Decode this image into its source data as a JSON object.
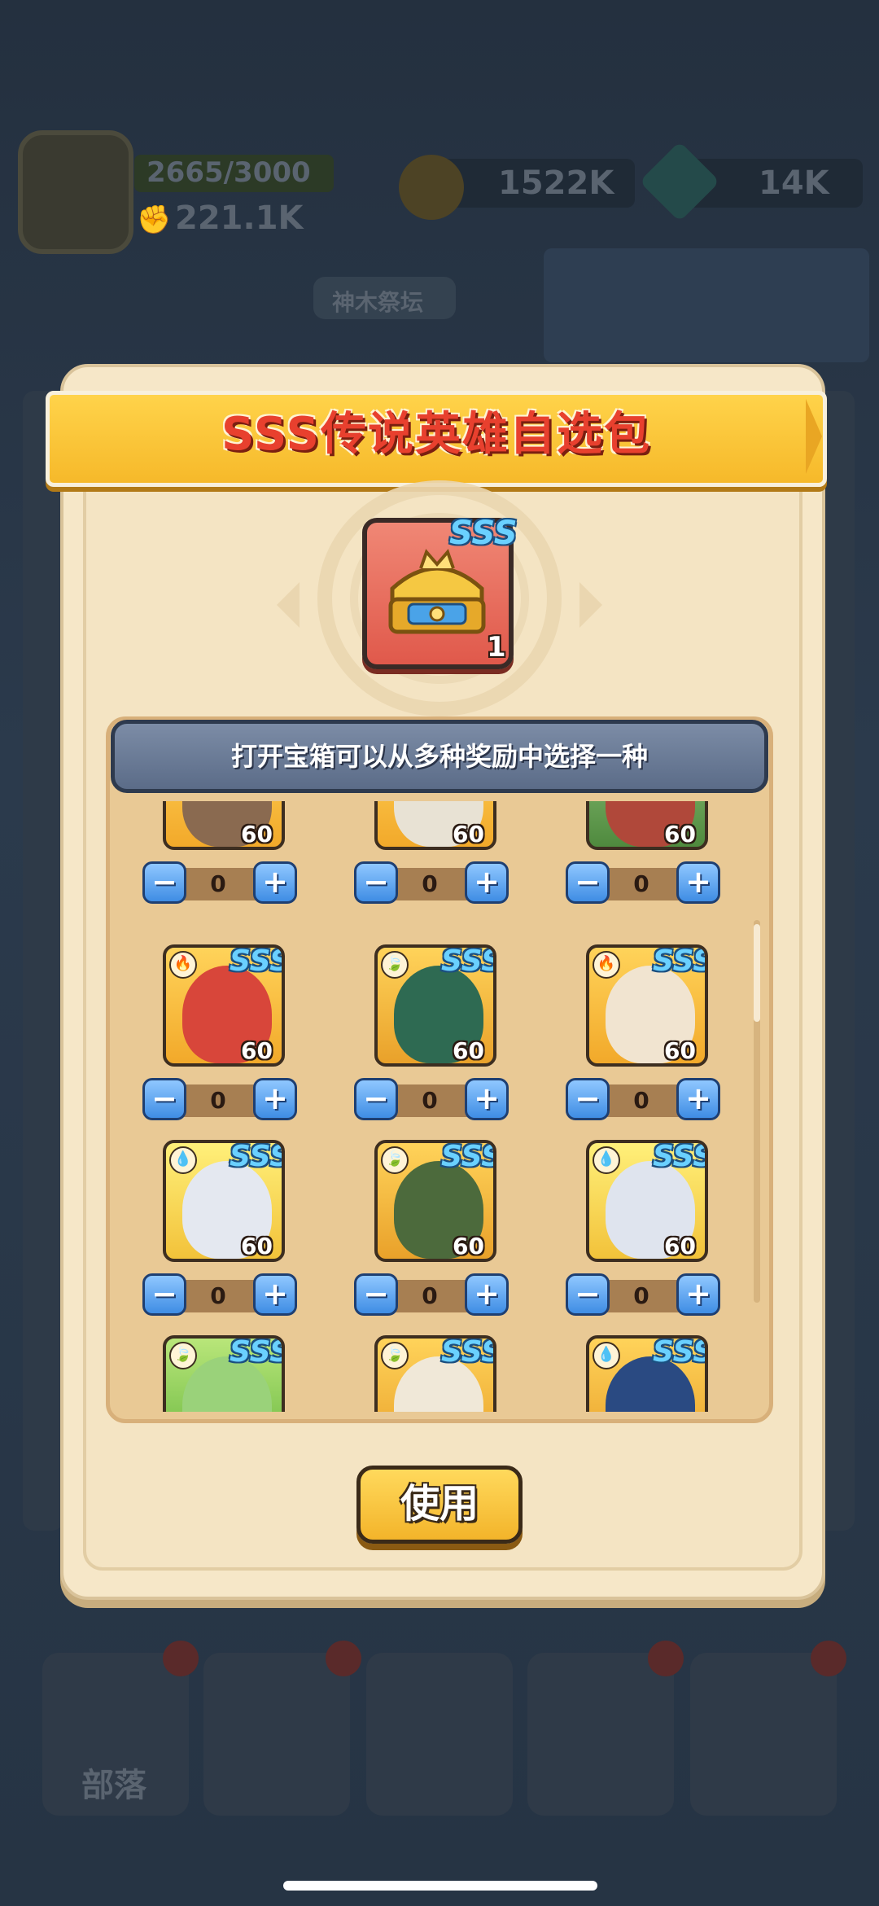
{
  "background": {
    "power_progress": "2665/3000",
    "combat_power": "221.1K",
    "gold": "1522K",
    "gems": "14K",
    "altar_label": "神木祭坛",
    "nav_tribe_label": "部落"
  },
  "modal": {
    "title": "SSS传说英雄自选包",
    "chest": {
      "grade": "SSS",
      "count": "1"
    },
    "instruction": "打开宝箱可以从多种奖励中选择一种",
    "use_button": "使用"
  },
  "heroes": [
    {
      "grade": "",
      "level": "60",
      "element": "",
      "quantity": "0",
      "minus": "−",
      "plus": "+"
    },
    {
      "grade": "",
      "level": "60",
      "element": "",
      "quantity": "0",
      "minus": "−",
      "plus": "+"
    },
    {
      "grade": "",
      "level": "60",
      "element": "",
      "quantity": "0",
      "minus": "−",
      "plus": "+"
    },
    {
      "grade": "SSS",
      "level": "60",
      "element": "fire",
      "quantity": "0",
      "minus": "−",
      "plus": "+"
    },
    {
      "grade": "SSS",
      "level": "60",
      "element": "leaf",
      "quantity": "0",
      "minus": "−",
      "plus": "+"
    },
    {
      "grade": "SSS",
      "level": "60",
      "element": "fire",
      "quantity": "0",
      "minus": "−",
      "plus": "+"
    },
    {
      "grade": "SSS",
      "level": "60",
      "element": "water",
      "quantity": "0",
      "minus": "−",
      "plus": "+"
    },
    {
      "grade": "SSS",
      "level": "60",
      "element": "leaf",
      "quantity": "0",
      "minus": "−",
      "plus": "+"
    },
    {
      "grade": "SSS",
      "level": "60",
      "element": "water",
      "quantity": "0",
      "minus": "−",
      "plus": "+"
    },
    {
      "grade": "SSS",
      "level": "",
      "element": "leaf",
      "quantity": "",
      "minus": "",
      "plus": ""
    },
    {
      "grade": "SSS",
      "level": "",
      "element": "leaf",
      "quantity": "",
      "minus": "",
      "plus": ""
    },
    {
      "grade": "SSS",
      "level": "",
      "element": "water",
      "quantity": "",
      "minus": "",
      "plus": ""
    }
  ],
  "colors": {
    "ribbon": "#f6b92a",
    "title_red": "#e8402e",
    "stepper_blue": "#3f8de4",
    "sss_blue": "#6ad0ff"
  }
}
